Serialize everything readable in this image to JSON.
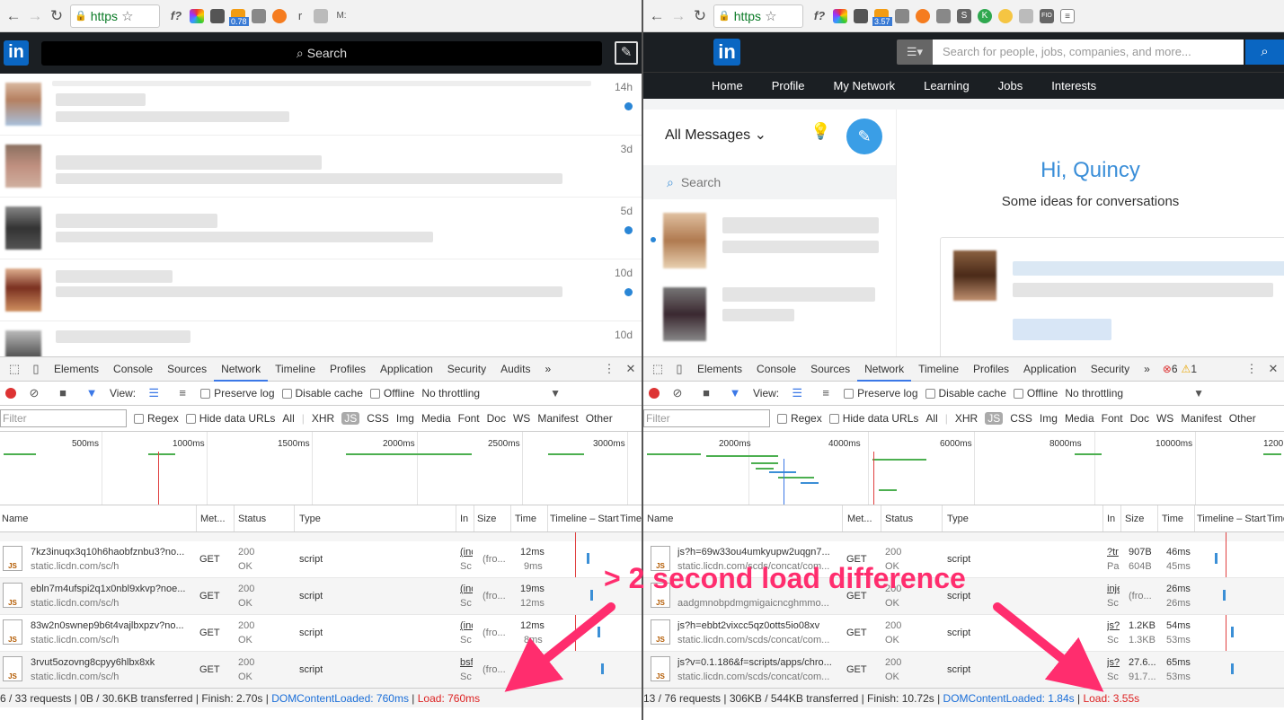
{
  "left_browser": {
    "url": "https",
    "ext_badge": "0.78",
    "ext_letter_r": "r",
    "ext_letter_m": "M:",
    "ext_fx": "f?",
    "linkedin": {
      "search": "Search",
      "messages": [
        {
          "time": "14h",
          "unread": true
        },
        {
          "time": "3d",
          "unread": false
        },
        {
          "time": "5d",
          "unread": true
        },
        {
          "time": "10d",
          "unread": true
        },
        {
          "time": "10d",
          "unread": false
        }
      ]
    },
    "devtools": {
      "tabs": [
        "Elements",
        "Console",
        "Sources",
        "Network",
        "Timeline",
        "Profiles",
        "Application",
        "Security",
        "Audits",
        "»"
      ],
      "view_label": "View:",
      "preserve_log": "Preserve log",
      "disable_cache": "Disable cache",
      "offline": "Offline",
      "throttling": "No throttling",
      "filter_placeholder": "Filter",
      "regex": "Regex",
      "hide_data_urls": "Hide data URLs",
      "types": [
        "All",
        "XHR",
        "JS",
        "CSS",
        "Img",
        "Media",
        "Font",
        "Doc",
        "WS",
        "Manifest",
        "Other"
      ],
      "ticks": [
        "500ms",
        "1000ms",
        "1500ms",
        "2000ms",
        "2500ms",
        "3000ms"
      ],
      "columns": [
        "Name",
        "Met...",
        "Status",
        "Type",
        "In",
        "Size",
        "Time",
        "Timeline – Start",
        "Time"
      ],
      "rows": [
        {
          "name": "7kz3inuqx3q10h6haobfznbu3?no...",
          "domain": "static.licdn.com/sc/h",
          "method": "GET",
          "status": "200",
          "status_text": "OK",
          "type": "script",
          "initiator": "(inc",
          "initiator_sub": "Sc",
          "size": "(fro...",
          "time": "12ms",
          "latency": "9ms"
        },
        {
          "name": "ebln7m4ufspi2q1x0nbl9xkvp?noe...",
          "domain": "static.licdn.com/sc/h",
          "method": "GET",
          "status": "200",
          "status_text": "OK",
          "type": "script",
          "initiator": "(inc",
          "initiator_sub": "Sc",
          "size": "(fro...",
          "time": "19ms",
          "latency": "12ms"
        },
        {
          "name": "83w2n0swnep9b6t4vajlbxpzv?no...",
          "domain": "static.licdn.com/sc/h",
          "method": "GET",
          "status": "200",
          "status_text": "OK",
          "type": "script",
          "initiator": "(inc",
          "initiator_sub": "Sc",
          "size": "(fro...",
          "time": "12ms",
          "latency": "8ms"
        },
        {
          "name": "3rvut5ozovng8cpyy6hlbx8xk",
          "domain": "static.licdn.com/sc/h",
          "method": "GET",
          "status": "200",
          "status_text": "OK",
          "type": "script",
          "initiator": "bsf",
          "initiator_sub": "Sc",
          "size": "(fro...",
          "time": "",
          "latency": ""
        }
      ],
      "summary": {
        "requests": "6 / 33 requests | 0B / 30.6KB transferred | Finish: 2.70s | ",
        "dom": "DOMContentLoaded: 760ms",
        "sep": " | ",
        "load": "Load: 760ms"
      }
    }
  },
  "right_browser": {
    "url": "https",
    "ext_badge": "3.57",
    "ext_fx": "f?",
    "linkedin": {
      "search_placeholder": "Search for people, jobs, companies, and more...",
      "nav": [
        "Home",
        "Profile",
        "My Network",
        "Learning",
        "Jobs",
        "Interests"
      ],
      "all_messages": "All Messages",
      "search": "Search",
      "greeting": "Hi, Quincy",
      "ideas": "Some ideas for conversations"
    },
    "devtools": {
      "tabs": [
        "Elements",
        "Console",
        "Sources",
        "Network",
        "Timeline",
        "Profiles",
        "Application",
        "Security",
        "»"
      ],
      "errors": "6",
      "warnings": "1",
      "view_label": "View:",
      "preserve_log": "Preserve log",
      "disable_cache": "Disable cache",
      "offline": "Offline",
      "throttling": "No throttling",
      "filter_placeholder": "Filter",
      "regex": "Regex",
      "hide_data_urls": "Hide data URLs",
      "types": [
        "All",
        "XHR",
        "JS",
        "CSS",
        "Img",
        "Media",
        "Font",
        "Doc",
        "WS",
        "Manifest",
        "Other"
      ],
      "ticks": [
        "2000ms",
        "4000ms",
        "6000ms",
        "8000ms",
        "10000ms",
        "1200"
      ],
      "columns": [
        "Name",
        "Met...",
        "Status",
        "Type",
        "In",
        "Size",
        "Time",
        "Timeline – Start",
        "Time"
      ],
      "rows": [
        {
          "name": "js?h=69w33ou4umkyupw2uqgn7...",
          "domain": "static.licdn.com/scds/concat/com...",
          "method": "GET",
          "status": "200",
          "status_text": "OK",
          "type": "script",
          "initiator": "?tr",
          "initiator_sub": "Pa",
          "size": "907B",
          "size_sub": "604B",
          "time": "46ms",
          "latency": "45ms"
        },
        {
          "name": "",
          "domain": "aadgmnobpdmgmigaicncghmmo...",
          "method": "GET",
          "status": "200",
          "status_text": "OK",
          "type": "script",
          "initiator": "inje",
          "initiator_sub": "Sc",
          "size": "(fro...",
          "size_sub": "",
          "time": "26ms",
          "latency": "26ms"
        },
        {
          "name": "js?h=ebbt2vixcc5qz0otts5io08xv",
          "domain": "static.licdn.com/scds/concat/com...",
          "method": "GET",
          "status": "200",
          "status_text": "OK",
          "type": "script",
          "initiator": "js?",
          "initiator_sub": "Sc",
          "size": "1.2KB",
          "size_sub": "1.3KB",
          "time": "54ms",
          "latency": "53ms"
        },
        {
          "name": "js?v=0.1.186&f=scripts/apps/chro...",
          "domain": "static.licdn.com/scds/concat/com...",
          "method": "GET",
          "status": "200",
          "status_text": "OK",
          "type": "script",
          "initiator": "js?",
          "initiator_sub": "Sc",
          "size": "27.6...",
          "size_sub": "91.7...",
          "time": "65ms",
          "latency": "53ms"
        }
      ],
      "summary": {
        "requests": "13 / 76 requests | 306KB / 544KB transferred | Finish: 10.72s | ",
        "dom": "DOMContentLoaded: 1.84s",
        "sep": " | ",
        "load": "Load: 3.55s"
      }
    }
  },
  "annotation": {
    "text": "> 2 second load difference",
    "color": "#ff2d6e"
  }
}
